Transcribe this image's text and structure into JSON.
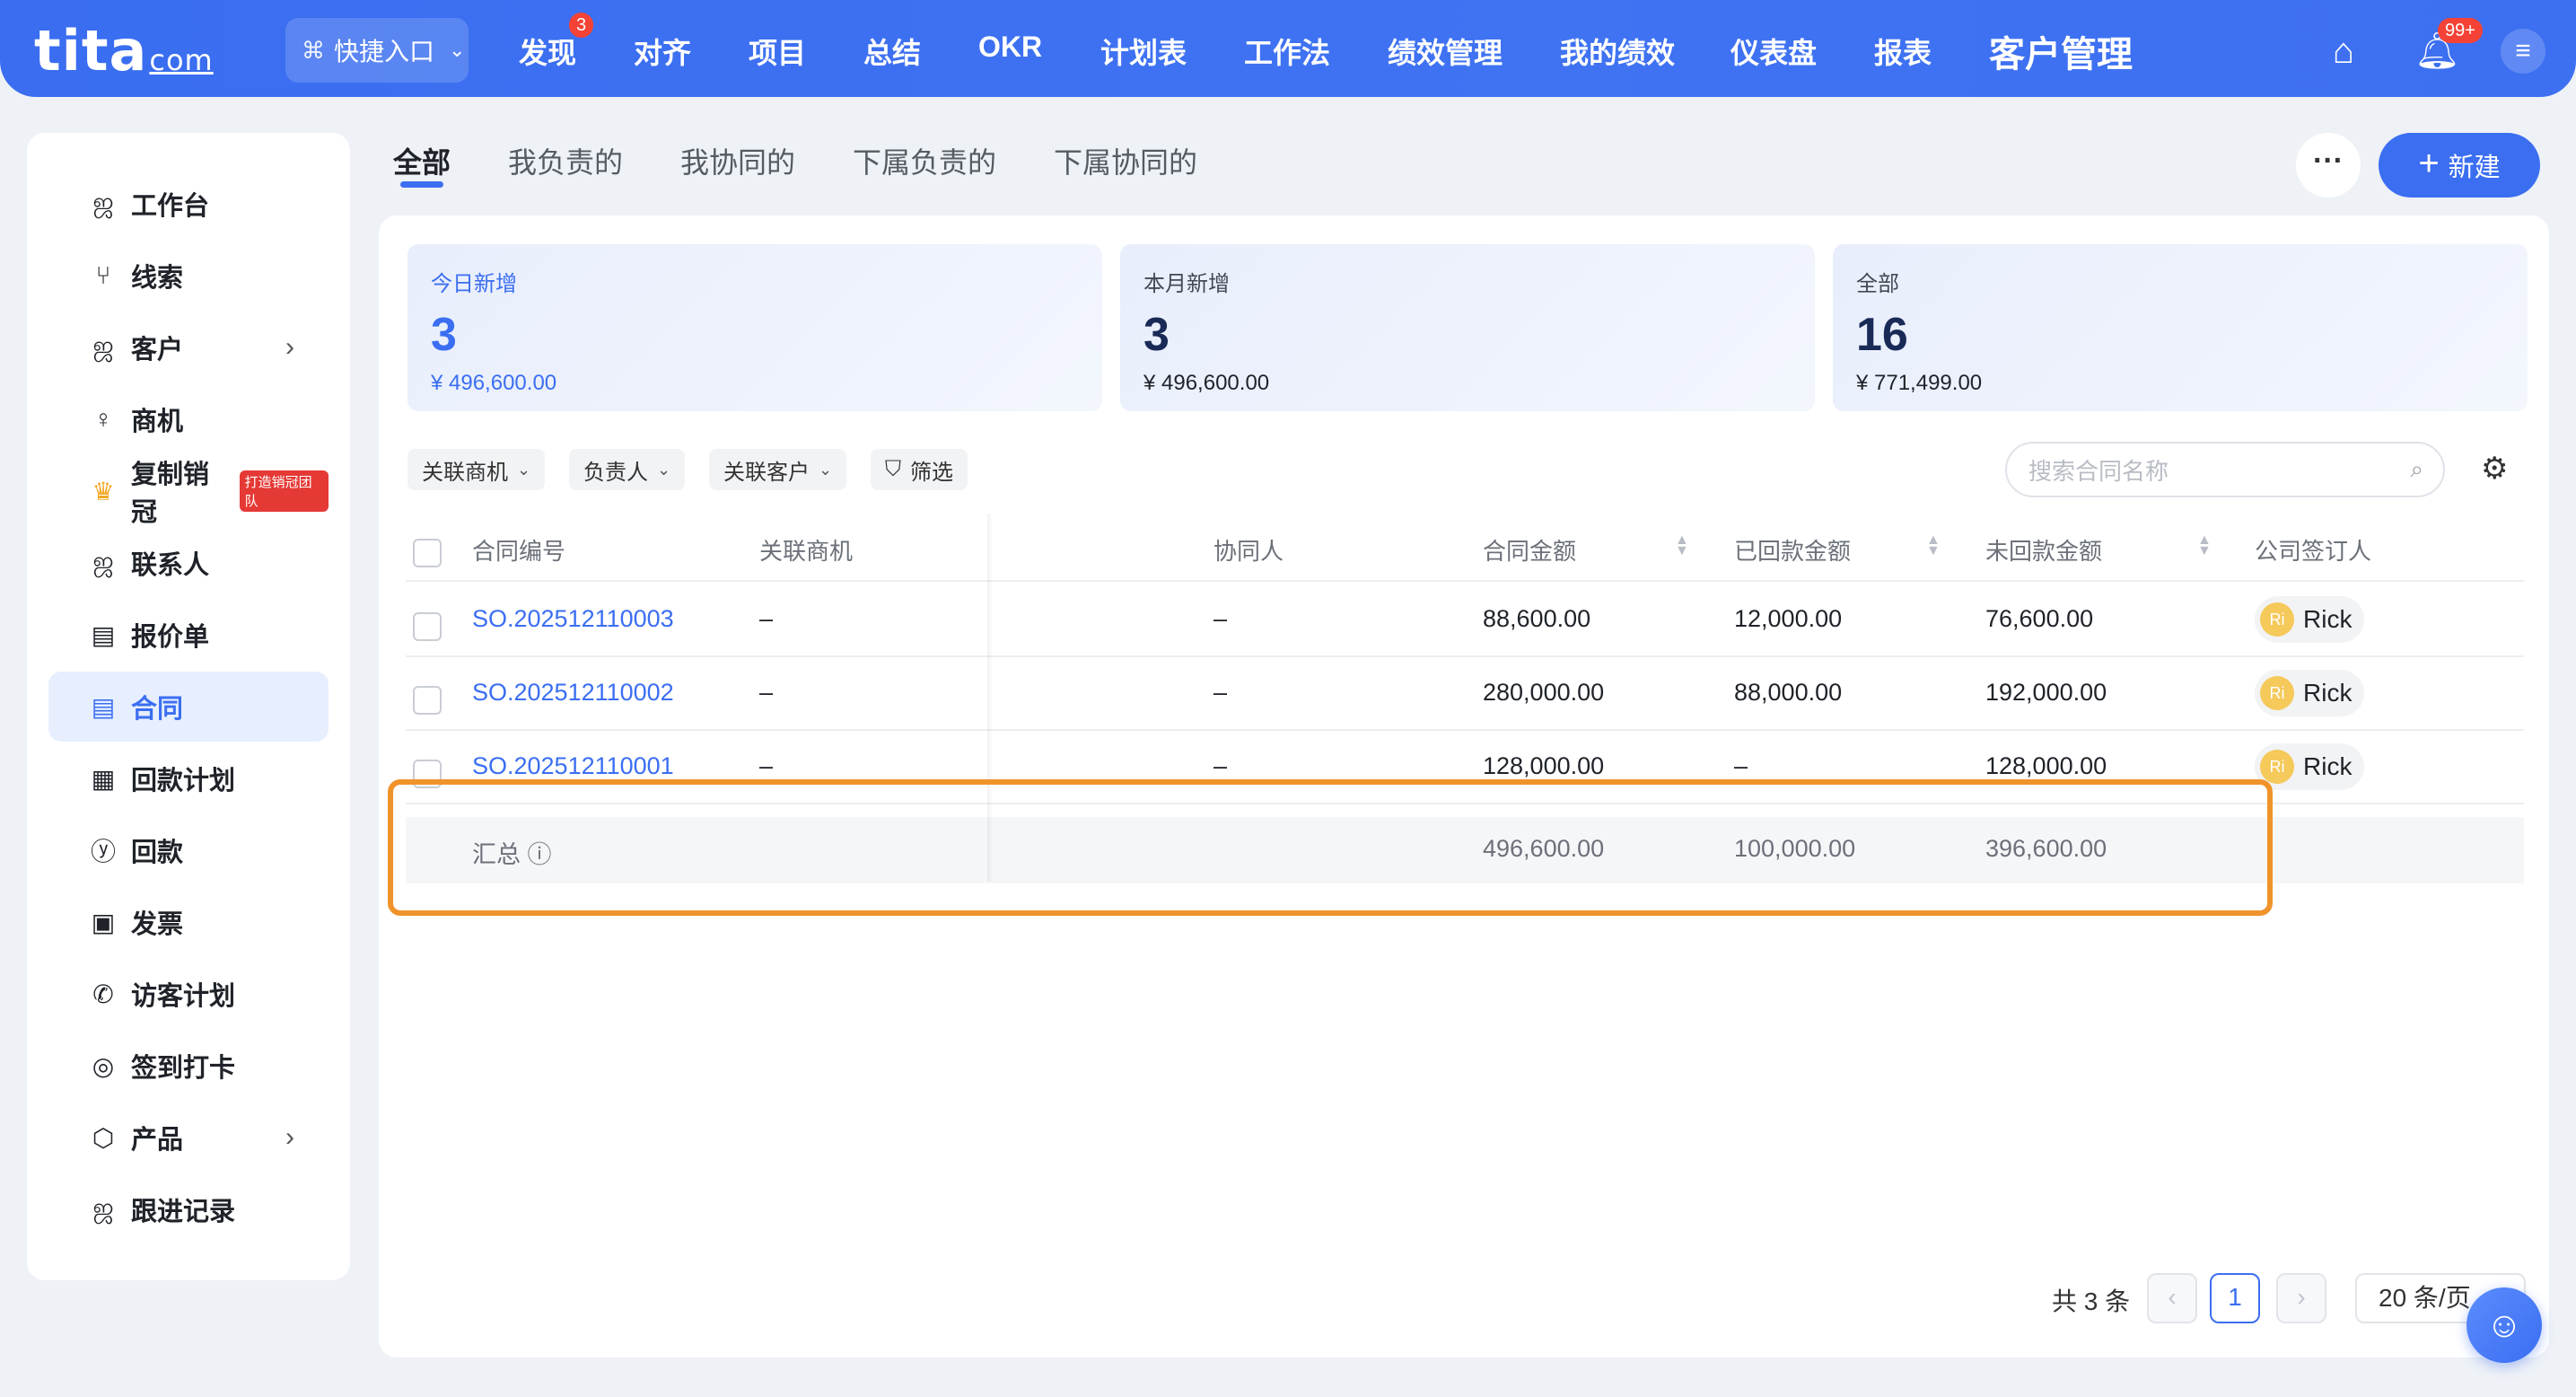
{
  "topbar": {
    "logo_main": "tita",
    "logo_sub": "com",
    "quick_entry": "快捷入口",
    "nav": [
      "发现",
      "对齐",
      "项目",
      "总结",
      "OKR",
      "计划表",
      "工作法",
      "绩效管理",
      "我的绩效",
      "仪表盘",
      "报表",
      "客户管理"
    ],
    "discover_badge": "3",
    "notif_badge": "99+",
    "icons": [
      "home-icon",
      "bell-icon",
      "menu-icon"
    ]
  },
  "sidebar": {
    "items": [
      {
        "label": "工作台",
        "icon": "people-icon"
      },
      {
        "label": "线索",
        "icon": "lead-icon"
      },
      {
        "label": "客户",
        "icon": "people-icon",
        "arrow": "›"
      },
      {
        "label": "商机",
        "icon": "bulb-icon"
      },
      {
        "label": "复制销冠",
        "icon": "crown-icon",
        "tag": "打造销冠团队"
      },
      {
        "label": "联系人",
        "icon": "people-icon"
      },
      {
        "label": "报价单",
        "icon": "doc-icon"
      },
      {
        "label": "合同",
        "icon": "contract-icon"
      },
      {
        "label": "回款计划",
        "icon": "calendar-icon"
      },
      {
        "label": "回款",
        "icon": "yen-icon"
      },
      {
        "label": "发票",
        "icon": "invoice-icon"
      },
      {
        "label": "访客计划",
        "icon": "phone-icon"
      },
      {
        "label": "签到打卡",
        "icon": "location-icon"
      },
      {
        "label": "产品",
        "icon": "box-icon",
        "arrow": "›"
      },
      {
        "label": "跟进记录",
        "icon": "people-icon"
      }
    ],
    "active_index": 7
  },
  "tabs": [
    "全部",
    "我负责的",
    "我协同的",
    "下属负责的",
    "下属协同的"
  ],
  "actions": {
    "more": "···",
    "new_label": "新建"
  },
  "stats": [
    {
      "label": "今日新增",
      "value": "3",
      "amount": "¥ 496,600.00"
    },
    {
      "label": "本月新增",
      "value": "3",
      "amount": "¥ 496,600.00"
    },
    {
      "label": "全部",
      "value": "16",
      "amount": "¥ 771,499.00"
    }
  ],
  "filters": [
    "关联商机",
    "负责人",
    "关联客户",
    "筛选"
  ],
  "search": {
    "placeholder": "搜索合同名称"
  },
  "table": {
    "headers": {
      "no": "合同编号",
      "opp": "关联商机",
      "collab": "协同人",
      "amount": "合同金额",
      "paid": "已回款金额",
      "unpaid": "未回款金额",
      "signer": "公司签订人"
    },
    "rows": [
      {
        "no": "SO.202512110003",
        "opp": "–",
        "collab": "–",
        "amount": "88,600.00",
        "paid": "12,000.00",
        "unpaid": "76,600.00",
        "signer": "Rick",
        "avatar": "Ri"
      },
      {
        "no": "SO.202512110002",
        "opp": "–",
        "collab": "–",
        "amount": "280,000.00",
        "paid": "88,000.00",
        "unpaid": "192,000.00",
        "signer": "Rick",
        "avatar": "Ri"
      },
      {
        "no": "SO.202512110001",
        "opp": "–",
        "collab": "–",
        "amount": "128,000.00",
        "paid": "–",
        "unpaid": "128,000.00",
        "signer": "Rick",
        "avatar": "Ri"
      }
    ],
    "summary": {
      "label": "汇总",
      "amount": "496,600.00",
      "paid": "100,000.00",
      "unpaid": "396,600.00"
    }
  },
  "pagination": {
    "total": "共 3 条",
    "current": "1",
    "page_size": "20 条/页"
  },
  "colors": {
    "accent": "#3b6ef1",
    "highlight": "#f0932b"
  }
}
